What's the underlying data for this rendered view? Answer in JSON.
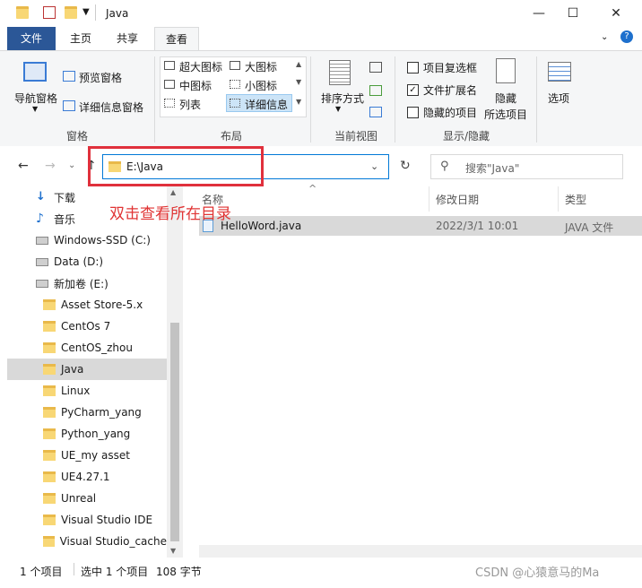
{
  "window": {
    "title": "Java",
    "controls": [
      "—",
      "☐",
      "✕"
    ]
  },
  "tabs": [
    {
      "label": "文件"
    },
    {
      "label": "主页"
    },
    {
      "label": "共享"
    },
    {
      "label": "查看"
    }
  ],
  "ribbon": {
    "panes": {
      "nav_pane": "导航窗格",
      "preview_pane": "预览窗格",
      "details_pane": "详细信息窗格",
      "group_label": "窗格"
    },
    "layout": {
      "items": [
        "超大图标",
        "大图标",
        "中图标",
        "小图标",
        "列表",
        "详细信息"
      ],
      "group_label": "布局"
    },
    "current_view": {
      "sort_by": "排序方式",
      "group_label": "当前视图"
    },
    "show_hide": {
      "item_checkbox": "项目复选框",
      "file_ext": "文件扩展名",
      "hidden_items": "隐藏的项目",
      "hide_selected_1": "隐藏",
      "hide_selected_2": "所选项目",
      "options": "选项",
      "group_label": "显示/隐藏"
    }
  },
  "address": {
    "path": "E:\\Java"
  },
  "search": {
    "placeholder": "搜索\"Java\""
  },
  "annotation": "双击查看所在目录",
  "columns": [
    "名称",
    "修改日期",
    "类型"
  ],
  "files": [
    {
      "name": "HelloWord.java",
      "date": "2022/3/1 10:01",
      "type": "JAVA 文件"
    }
  ],
  "nav_tree": [
    {
      "label": "下载",
      "icon": "download-icon"
    },
    {
      "label": "音乐",
      "icon": "music-icon"
    },
    {
      "label": "Windows-SSD (C:)",
      "icon": "drive-icon"
    },
    {
      "label": "Data (D:)",
      "icon": "drive-icon"
    },
    {
      "label": "新加卷 (E:)",
      "icon": "drive-icon"
    },
    {
      "label": "Asset Store-5.x",
      "icon": "folder-icon"
    },
    {
      "label": "CentOs 7",
      "icon": "folder-icon"
    },
    {
      "label": "CentOS_zhou",
      "icon": "folder-icon"
    },
    {
      "label": "Java",
      "icon": "folder-icon"
    },
    {
      "label": "Linux",
      "icon": "folder-icon"
    },
    {
      "label": "PyCharm_yang",
      "icon": "folder-icon"
    },
    {
      "label": "Python_yang",
      "icon": "folder-icon"
    },
    {
      "label": "UE_my asset",
      "icon": "folder-icon"
    },
    {
      "label": "UE4.27.1",
      "icon": "folder-icon"
    },
    {
      "label": "Unreal",
      "icon": "folder-icon"
    },
    {
      "label": "Visual Studio IDE",
      "icon": "folder-icon"
    },
    {
      "label": "Visual Studio_cache",
      "icon": "folder-icon"
    }
  ],
  "status": {
    "count": "1 个项目",
    "selected": "选中 1 个项目",
    "size": "108 字节"
  },
  "watermark": "CSDN @心猿意马的Ma"
}
